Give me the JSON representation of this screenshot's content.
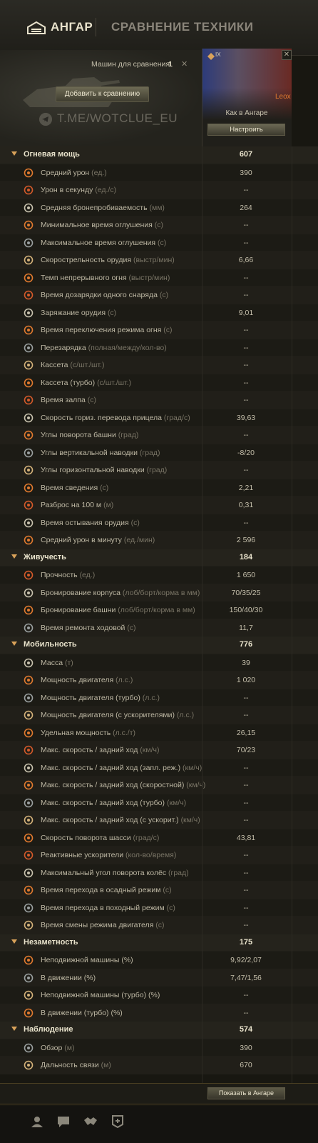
{
  "header": {
    "hangar": "АНГАР",
    "compare": "СРАВНЕНИЕ ТЕХНИКИ",
    "count_label": "Машин для сравнения:",
    "count_value": "1",
    "add_button": "Добавить к сравнению",
    "watermark": "T.ME/WOTCLUE_EU"
  },
  "tank": {
    "tier": "IX",
    "name": "Leox",
    "as_in_hangar": "Как в Ангаре",
    "configure": "Настроить"
  },
  "footer": {
    "show_in_hangar": "Показать в Ангаре"
  },
  "colors": {
    "accent": "#e07a2f",
    "group_text": "#e9e3cc",
    "bg": "#181711"
  },
  "groups": [
    {
      "name": "Огневая мощь",
      "value": "607",
      "rows": [
        {
          "icon": "damage-icon",
          "label": "Средний урон",
          "unit": "(ед.)",
          "value": "390"
        },
        {
          "icon": "dps-icon",
          "label": "Урон в секунду",
          "unit": "(ед./с)",
          "value": "--"
        },
        {
          "icon": "penetration-icon",
          "label": "Средняя бронепробиваемость",
          "unit": "(мм)",
          "value": "264"
        },
        {
          "icon": "stun-min-icon",
          "label": "Минимальное время оглушения",
          "unit": "(с)",
          "value": "--"
        },
        {
          "icon": "stun-max-icon",
          "label": "Максимальное время оглушения",
          "unit": "(с)",
          "value": "--"
        },
        {
          "icon": "rate-of-fire-icon",
          "label": "Скорострельность орудия",
          "unit": "(выстр/мин)",
          "value": "6,66"
        },
        {
          "icon": "continuous-fire-icon",
          "label": "Темп непрерывного огня",
          "unit": "(выстр/мин)",
          "value": "--"
        },
        {
          "icon": "single-reload-icon",
          "label": "Время дозарядки одного снаряда",
          "unit": "(с)",
          "value": "--"
        },
        {
          "icon": "reload-icon",
          "label": "Заряжание орудия",
          "unit": "(с)",
          "value": "9,01"
        },
        {
          "icon": "fire-mode-icon",
          "label": "Время переключения режима огня",
          "unit": "(с)",
          "value": "--"
        },
        {
          "icon": "reload-full-icon",
          "label": "Перезарядка",
          "unit": "(полная/между/кол-во)",
          "value": "--"
        },
        {
          "icon": "clip-icon",
          "label": "Кассета",
          "unit": "(с/шт./шт.)",
          "value": "--"
        },
        {
          "icon": "clip-turbo-icon",
          "label": "Кассета (турбо)",
          "unit": "(с/шт./шт.)",
          "value": "--"
        },
        {
          "icon": "salvo-icon",
          "label": "Время залпа",
          "unit": "(с)",
          "value": "--"
        },
        {
          "icon": "aim-traverse-icon",
          "label": "Скорость гориз. перевода прицела",
          "unit": "(град/с)",
          "value": "39,63"
        },
        {
          "icon": "turret-rotation-icon",
          "label": "Углы поворота башни",
          "unit": "(град)",
          "value": "--"
        },
        {
          "icon": "elevation-icon",
          "label": "Углы вертикальной наводки",
          "unit": "(град)",
          "value": "-8/20"
        },
        {
          "icon": "horizontal-aim-icon",
          "label": "Углы горизонтальной наводки",
          "unit": "(град)",
          "value": "--"
        },
        {
          "icon": "aim-time-icon",
          "label": "Время сведения",
          "unit": "(с)",
          "value": "2,21"
        },
        {
          "icon": "dispersion-icon",
          "label": "Разброс на 100 м",
          "unit": "(м)",
          "value": "0,31"
        },
        {
          "icon": "cooldown-icon",
          "label": "Время остывания орудия",
          "unit": "(с)",
          "value": "--"
        },
        {
          "icon": "damage-per-minute-icon",
          "label": "Средний урон в минуту",
          "unit": "(ед./мин)",
          "value": "2 596"
        }
      ]
    },
    {
      "name": "Живучесть",
      "value": "184",
      "rows": [
        {
          "icon": "hitpoints-icon",
          "label": "Прочность",
          "unit": "(ед.)",
          "value": "1 650"
        },
        {
          "icon": "hull-armor-icon",
          "label": "Бронирование корпуса",
          "unit": "(лоб/борт/корма в мм)",
          "value": "70/35/25"
        },
        {
          "icon": "turret-armor-icon",
          "label": "Бронирование башни",
          "unit": "(лоб/борт/корма в мм)",
          "value": "150/40/30"
        },
        {
          "icon": "repair-icon",
          "label": "Время ремонта ходовой",
          "unit": "(с)",
          "value": "11,7"
        }
      ]
    },
    {
      "name": "Мобильность",
      "value": "776",
      "rows": [
        {
          "icon": "weight-icon",
          "label": "Масса",
          "unit": "(т)",
          "value": "39"
        },
        {
          "icon": "engine-icon",
          "label": "Мощность двигателя",
          "unit": "(л.с.)",
          "value": "1 020"
        },
        {
          "icon": "engine-turbo-icon",
          "label": "Мощность двигателя (турбо)",
          "unit": "(л.с.)",
          "value": "--"
        },
        {
          "icon": "engine-boost-icon",
          "label": "Мощность двигателя (с ускорителями)",
          "unit": "(л.с.)",
          "value": "--"
        },
        {
          "icon": "specific-power-icon",
          "label": "Удельная мощность",
          "unit": "(л.с./т)",
          "value": "26,15"
        },
        {
          "icon": "speed-icon",
          "label": "Макс. скорость / задний ход",
          "unit": "(км/ч)",
          "value": "70/23"
        },
        {
          "icon": "speed-reserve-icon",
          "label": "Макс. скорость / задний ход (запл. реж.)",
          "unit": "(км/ч)",
          "value": "--"
        },
        {
          "icon": "speed-fast-icon",
          "label": "Макс. скорость / задний ход (скоростной)",
          "unit": "(км/ч)",
          "value": "--"
        },
        {
          "icon": "speed-turbo-icon",
          "label": "Макс. скорость / задний ход (турбо)",
          "unit": "(км/ч)",
          "value": "--"
        },
        {
          "icon": "speed-boost-icon",
          "label": "Макс. скорость / задний ход (с ускорит.)",
          "unit": "(км/ч)",
          "value": "--"
        },
        {
          "icon": "chassis-rotation-icon",
          "label": "Скорость поворота шасси",
          "unit": "(град/с)",
          "value": "43,81"
        },
        {
          "icon": "rocket-booster-icon",
          "label": "Реактивные ускорители",
          "unit": "(кол-во/время)",
          "value": "--"
        },
        {
          "icon": "wheel-angle-icon",
          "label": "Максимальный угол поворота колёс",
          "unit": "(град)",
          "value": "--"
        },
        {
          "icon": "siege-mode-icon",
          "label": "Время перехода в осадный режим",
          "unit": "(с)",
          "value": "--"
        },
        {
          "icon": "travel-mode-icon",
          "label": "Время перехода в походный режим",
          "unit": "(с)",
          "value": "--"
        },
        {
          "icon": "engine-mode-icon",
          "label": "Время смены режима двигателя",
          "unit": "(с)",
          "value": "--"
        }
      ]
    },
    {
      "name": "Незаметность",
      "value": "175",
      "rows": [
        {
          "icon": "camo-still-icon",
          "label": "Неподвижной машины (%)",
          "unit": "",
          "value": "9,92/2,07"
        },
        {
          "icon": "camo-moving-icon",
          "label": "В движении (%)",
          "unit": "",
          "value": "7,47/1,56"
        },
        {
          "icon": "camo-still-turbo-icon",
          "label": "Неподвижной машины (турбо) (%)",
          "unit": "",
          "value": "--"
        },
        {
          "icon": "camo-moving-turbo-icon",
          "label": "В движении (турбо) (%)",
          "unit": "",
          "value": "--"
        }
      ]
    },
    {
      "name": "Наблюдение",
      "value": "574",
      "rows": [
        {
          "icon": "view-range-icon",
          "label": "Обзор",
          "unit": "(м)",
          "value": "390"
        },
        {
          "icon": "radio-range-icon",
          "label": "Дальность связи",
          "unit": "(м)",
          "value": "670"
        }
      ]
    }
  ]
}
